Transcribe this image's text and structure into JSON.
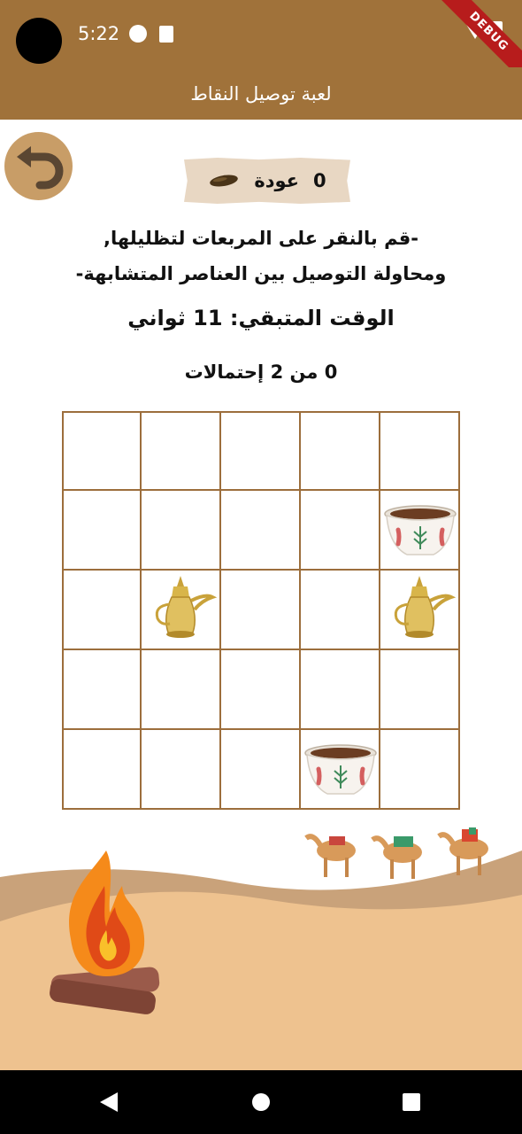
{
  "status_bar": {
    "time": "5:22",
    "debug_label": "DEBUG",
    "icons": [
      "camera-cutout",
      "data-saver-icon",
      "sd-card-icon",
      "wifi-icon",
      "battery-icon"
    ]
  },
  "app_bar": {
    "title": "لعبة توصيل النقاط",
    "color": "#a0723a"
  },
  "back_button": {
    "icon": "undo-arrow-icon"
  },
  "returns": {
    "count": "0",
    "label": "عودة",
    "icon": "date-fruit-icon"
  },
  "instructions": {
    "line1": "-قم بالنقر على المربعات لتظليلها,",
    "line2": "ومحاولة التوصيل بين العناصر المتشابهة-"
  },
  "timer": {
    "label": "الوقت المتبقي:",
    "value": "11",
    "unit": "ثواني"
  },
  "attempts": {
    "current": "0",
    "separator": "من",
    "total": "2",
    "label": "إحتمالات"
  },
  "grid": {
    "rows": 5,
    "cols": 5,
    "border_color": "#9c6e3c",
    "items": [
      {
        "row": 1,
        "col": 4,
        "type": "coffee-cup"
      },
      {
        "row": 2,
        "col": 1,
        "type": "dallah-pot"
      },
      {
        "row": 2,
        "col": 4,
        "type": "dallah-pot"
      },
      {
        "row": 4,
        "col": 3,
        "type": "coffee-cup"
      }
    ]
  },
  "scene": {
    "elements": [
      "campfire-icon",
      "camel-caravan-illustration",
      "sand-dunes"
    ]
  },
  "nav_bar": {
    "icons": [
      "nav-back-icon",
      "nav-home-icon",
      "nav-recents-icon"
    ]
  }
}
